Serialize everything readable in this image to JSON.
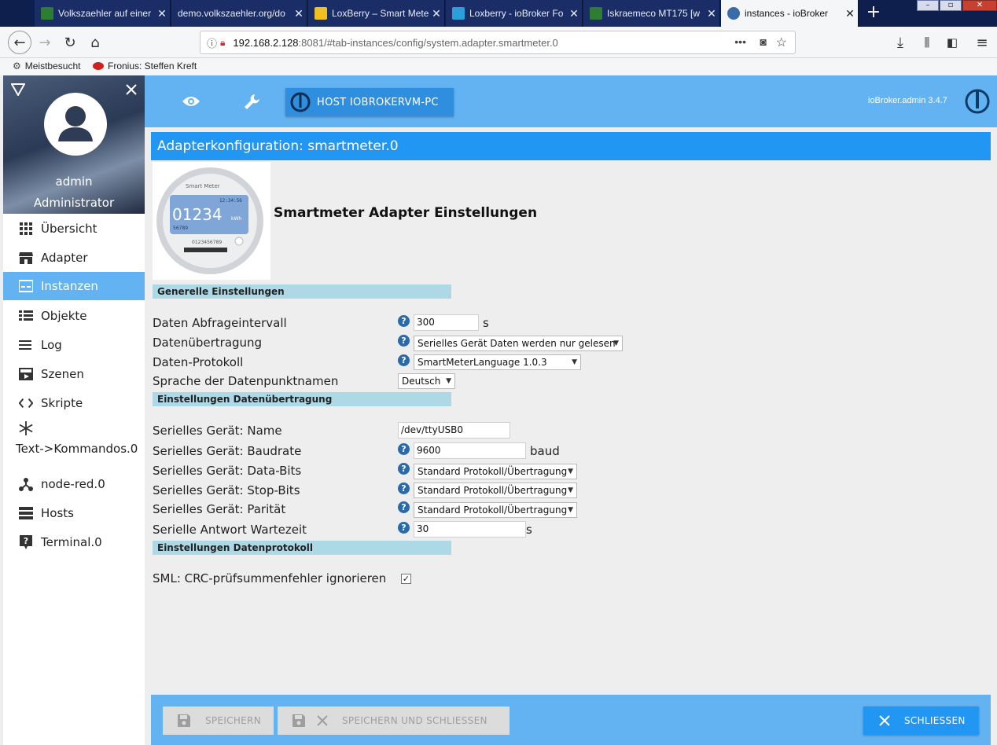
{
  "browser": {
    "tabs": [
      {
        "title": "Volkszaehler auf einer"
      },
      {
        "title": "demo.volkszaehler.org/do"
      },
      {
        "title": "LoxBerry – Smart Meter"
      },
      {
        "title": "Loxberry - ioBroker Fo"
      },
      {
        "title": "Iskraemeco MT175 [w"
      },
      {
        "title": "instances - ioBroker"
      }
    ],
    "url_host": "192.168.2.128",
    "url_rest": ":8081/#tab-instances/config/system.adapter.smartmeter.0",
    "bookmarks": [
      {
        "label": "Meistbesucht"
      },
      {
        "label": "Fronius: Steffen Kreft"
      }
    ]
  },
  "sidebar": {
    "user_name": "admin",
    "user_role": "Administrator",
    "items": [
      {
        "label": "Übersicht",
        "icon": "grid-icon"
      },
      {
        "label": "Adapter",
        "icon": "store-icon"
      },
      {
        "label": "Instanzen",
        "icon": "instances-icon"
      },
      {
        "label": "Objekte",
        "icon": "list-icon"
      },
      {
        "label": "Log",
        "icon": "log-icon"
      },
      {
        "label": "Szenen",
        "icon": "scenes-icon"
      },
      {
        "label": "Skripte",
        "icon": "code-icon"
      },
      {
        "label": "Text->Kommandos.0",
        "icon": "snowflake-icon"
      },
      {
        "label": "node-red.0",
        "icon": "node-red-icon"
      },
      {
        "label": "Hosts",
        "icon": "hosts-icon"
      },
      {
        "label": "Terminal.0",
        "icon": "terminal-icon"
      }
    ]
  },
  "header": {
    "host_button": "HOST IOBROKERVM-PC",
    "version": "ioBroker.admin 3.4.7"
  },
  "config": {
    "bar_title": "Adapterkonfiguration: smartmeter.0",
    "title": "Smartmeter Adapter Einstellungen",
    "meter_image": {
      "brand": "Smart Meter",
      "time": "12:34:56",
      "reading": "01234",
      "unit": "kWh",
      "sub": "56789",
      "serial": "0123456789"
    },
    "sections": {
      "general": "Generelle Einstellungen",
      "transfer": "Einstellungen Datenübertragung",
      "protocol": "Einstellungen Datenprotokoll"
    },
    "general": {
      "interval_label": "Daten Abfrageintervall",
      "interval_value": "300",
      "interval_unit": "s",
      "transfer_label": "Datenübertragung",
      "transfer_value": "Serielles Gerät Daten werden nur gelesen",
      "protocol_label": "Daten-Protokoll",
      "protocol_value": "SmartMeterLanguage 1.0.3",
      "language_label": "Sprache der Datenpunktnamen",
      "language_value": "Deutsch"
    },
    "transfer": {
      "device_label": "Serielles Gerät: Name",
      "device_value": "/dev/ttyUSB0",
      "baud_label": "Serielles Gerät: Baudrate",
      "baud_value": "9600",
      "baud_unit": "baud",
      "databits_label": "Serielles Gerät: Data-Bits",
      "databits_value": "Standard Protokoll/Übertragung",
      "stopbits_label": "Serielles Gerät: Stop-Bits",
      "stopbits_value": "Standard Protokoll/Übertragung",
      "parity_label": "Serielles Gerät: Parität",
      "parity_value": "Standard Protokoll/Übertragung",
      "wait_label": "Serielle Antwort Wartezeit",
      "wait_value": "30",
      "wait_unit": "s"
    },
    "protocol": {
      "crc_label": "SML: CRC-prüfsummenfehler ignorieren",
      "crc_checked": true
    }
  },
  "footer": {
    "save": "SPEICHERN",
    "save_close": "SPEICHERN UND SCHLIESSEN",
    "close": "SCHLIESSEN"
  },
  "colors": {
    "accent": "#2196f3",
    "header": "#63b3f3",
    "section": "#add8e6"
  }
}
